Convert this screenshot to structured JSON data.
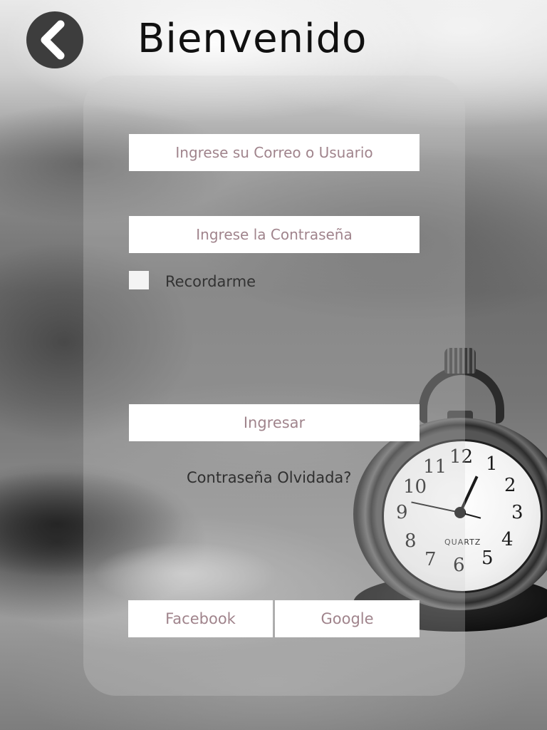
{
  "header": {
    "title": "Bienvenido",
    "back_icon": "chevron-left-icon"
  },
  "form": {
    "email_placeholder": "Ingrese su Correo o Usuario",
    "password_placeholder": "Ingrese la Contraseña",
    "remember_label": "Recordarme",
    "remember_checked": false,
    "login_label": "Ingresar",
    "forgot_label": "Contraseña Olvidada?"
  },
  "social": {
    "facebook_label": "Facebook",
    "google_label": "Google"
  },
  "background": {
    "watch_label": "QUARTZ",
    "dial_numbers": [
      "12",
      "1",
      "2",
      "3",
      "4",
      "5",
      "6",
      "7",
      "8",
      "9",
      "10",
      "11"
    ]
  },
  "colors": {
    "button_text": "#a0848c",
    "back_button": "#3d3d3d"
  }
}
